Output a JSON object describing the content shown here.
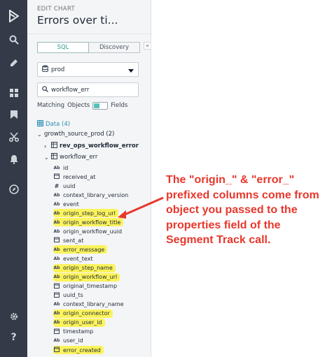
{
  "header": {
    "breadcrumb": "EDIT CHART",
    "title": "Errors over ti..."
  },
  "tabs": [
    {
      "label": "SQL",
      "active": true
    },
    {
      "label": "Discovery",
      "active": false
    }
  ],
  "collapse_glyph": "«",
  "database": {
    "selected": "prod"
  },
  "search": {
    "value": "workflow_err"
  },
  "matching": {
    "label": "Matching",
    "option_left": "Objects",
    "option_right": "Fields"
  },
  "data_tree": {
    "header_label": "Data",
    "header_count": "(4)",
    "schema": {
      "name": "growth_source_prod",
      "count": "(2)"
    },
    "tables": [
      {
        "name": "rev_ops_workflow_error",
        "expanded": false
      },
      {
        "name": "workflow_err",
        "expanded": true
      }
    ],
    "columns": [
      {
        "type": "Ab",
        "name": "id",
        "highlighted": false
      },
      {
        "type": "cal",
        "name": "received_at",
        "highlighted": false
      },
      {
        "type": "#",
        "name": "uuid",
        "highlighted": false
      },
      {
        "type": "Ab",
        "name": "context_library_version",
        "highlighted": false
      },
      {
        "type": "Ab",
        "name": "event",
        "highlighted": false
      },
      {
        "type": "Ab",
        "name": "origin_step_log_url",
        "highlighted": true
      },
      {
        "type": "Ab",
        "name": "origin_workflow_title",
        "highlighted": true
      },
      {
        "type": "Ab",
        "name": "origin_workflow_uuid",
        "highlighted": false
      },
      {
        "type": "cal",
        "name": "sent_at",
        "highlighted": false
      },
      {
        "type": "Ab",
        "name": "error_message",
        "highlighted": true
      },
      {
        "type": "Ab",
        "name": "event_text",
        "highlighted": false
      },
      {
        "type": "Ab",
        "name": "origin_step_name",
        "highlighted": true
      },
      {
        "type": "Ab",
        "name": "origin_workflow_url",
        "highlighted": true
      },
      {
        "type": "cal",
        "name": "original_timestamp",
        "highlighted": false
      },
      {
        "type": "cal",
        "name": "uuid_ts",
        "highlighted": false
      },
      {
        "type": "Ab",
        "name": "context_library_name",
        "highlighted": false
      },
      {
        "type": "Ab",
        "name": "origin_connector",
        "highlighted": true
      },
      {
        "type": "Ab",
        "name": "origin_user_id",
        "highlighted": true
      },
      {
        "type": "cal",
        "name": "timestamp",
        "highlighted": false
      },
      {
        "type": "Ab",
        "name": "user_id",
        "highlighted": false
      },
      {
        "type": "cal",
        "name": "error_created",
        "highlighted": true
      }
    ]
  },
  "annotation": {
    "text": "The \"origin_\" & \"error_\" prefixed columns come from object you passed to the properties field of the Segment Track call.",
    "color": "#e8372c"
  },
  "colors": {
    "rail": "#343a47",
    "highlight": "#fbf35c",
    "accent": "#2a9d8f"
  },
  "rail_icons": [
    "logo-icon",
    "search-icon",
    "edit-icon",
    "dashboard-icon",
    "bookmark-icon",
    "scissors-icon",
    "bell-icon",
    "compass-icon",
    "settings-icon",
    "help-icon"
  ]
}
